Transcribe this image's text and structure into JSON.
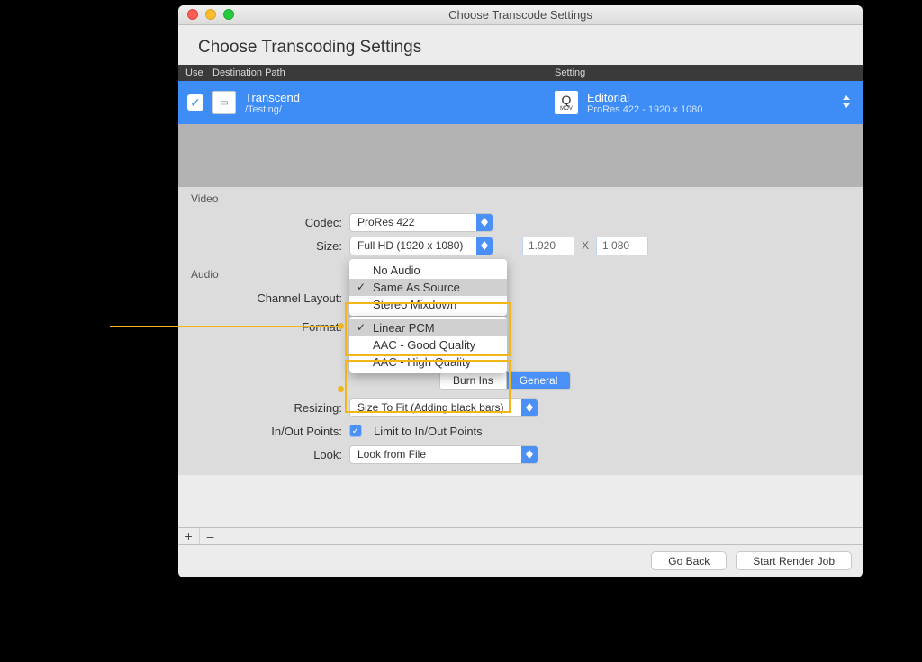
{
  "window": {
    "title": "Choose Transcode Settings"
  },
  "heading": "Choose Transcoding Settings",
  "table_head": {
    "use": "Use",
    "dest": "Destination Path",
    "setting": "Setting"
  },
  "dest_row": {
    "title": "Transcend",
    "path": "/Testing/",
    "setting_title": "Editorial",
    "setting_sub": "ProRes 422 - 1920 x 1080"
  },
  "video": {
    "section": "Video",
    "codec_label": "Codec:",
    "codec_value": "ProRes 422",
    "size_label": "Size:",
    "size_value": "Full HD (1920 x 1080)",
    "width": "1.920",
    "height": "1.080",
    "times": "X"
  },
  "audio": {
    "section": "Audio",
    "channel_label": "Channel Layout:",
    "channel_menu": {
      "items": [
        "No Audio",
        "Same As Source",
        "Stereo Mixdown"
      ],
      "selected": "Same As Source"
    },
    "format_label": "Format:",
    "format_menu": {
      "items": [
        "Linear PCM",
        "AAC - Good Quality",
        "AAC - High Quality"
      ],
      "selected": "Linear PCM"
    }
  },
  "tabs": {
    "burnins": "Burn Ins",
    "general": "General"
  },
  "general": {
    "resizing_label": "Resizing:",
    "resizing_value": "Size To Fit (Adding black bars)",
    "inout_label": "In/Out Points:",
    "inout_value": "Limit to In/Out Points",
    "look_label": "Look:",
    "look_value": "Look from File"
  },
  "footer": {
    "plus": "+",
    "minus": "–"
  },
  "buttons": {
    "back": "Go Back",
    "start": "Start Render Job"
  }
}
